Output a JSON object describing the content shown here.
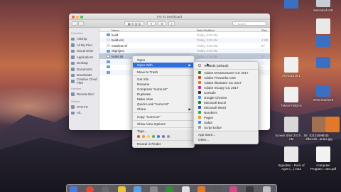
{
  "finder": {
    "title": "FIX IO Dashboard",
    "search_placeholder": "Search",
    "col_name": "Name",
    "col_date": "Date Modified",
    "col_size": "Size",
    "sidebar_heading_favorites": "Favorites",
    "sidebar_favorites": [
      "AirDrop",
      "All My Files",
      "iCloud Drive",
      "Applications",
      "Desktop",
      "Documents",
      "Downloads",
      "Creative Cloud Files"
    ],
    "sidebar_heading_devices": "Devices",
    "sidebar_devices": [
      "Remote Disc"
    ],
    "sidebar_heading_shared": "Shared",
    "sidebar_shared": [
      "STG-FS",
      "All..."
    ],
    "rows": [
      {
        "name": "build",
        "date": "Today, 3:00 AM",
        "size": "--"
      },
      {
        "name": "build.xml",
        "date": "Today, 3:00 AM",
        "size": "4 KB"
      },
      {
        "name": "manifest.mf",
        "date": "Today, 3:00 AM",
        "size": "97 bytes"
      },
      {
        "name": "nbproject",
        "date": "Today, 3:00 AM",
        "size": "--"
      },
      {
        "name": "nums.txt",
        "date": "Today, 3:00 AM",
        "size": "21 bytes"
      },
      {
        "name": "",
        "date": "Today, 3:00 AM",
        "size": "--"
      },
      {
        "name": "",
        "date": "Today, 3:00 AM",
        "size": "--"
      },
      {
        "name": "",
        "date": "Today, 3:00 AM",
        "size": "--"
      }
    ]
  },
  "context_menu": {
    "open": "Open",
    "open_with": "Open With",
    "move_to_trash": "Move to Trash",
    "get_info": "Get Info",
    "rename": "Rename",
    "compress": "Compress \"nums.txt\"",
    "duplicate": "Duplicate",
    "make_alias": "Make Alias",
    "quick_look": "Quick Look \"nums.txt\"",
    "share": "Share",
    "copy": "Copy \"nums.txt\"",
    "show_view_options": "Show View Options",
    "tags": "Tags...",
    "reveal": "Reveal in Finder"
  },
  "open_with_menu": {
    "items": [
      {
        "label": "TextEdit (default)",
        "color": "#e8e8e8"
      },
      {
        "label": "Adobe Dreamweaver CC 2017",
        "color": "#3a7d3a"
      },
      {
        "label": "Adobe Fireworks CS6",
        "color": "#b5502b"
      },
      {
        "label": "Adobe Illustrator CC 2017",
        "color": "#d97a1a"
      },
      {
        "label": "Adobe InCopy CC 2017",
        "color": "#b03a7a"
      },
      {
        "label": "Console",
        "color": "#333333"
      },
      {
        "label": "Google Chrome",
        "color": "#4a8fd9"
      },
      {
        "label": "Microsoft Excel",
        "color": "#1f7a3a"
      },
      {
        "label": "Microsoft Word",
        "color": "#2a56a8"
      },
      {
        "label": "Numbers",
        "color": "#3ea54a"
      },
      {
        "label": "Pages",
        "color": "#e89a2a"
      },
      {
        "label": "Safari",
        "color": "#3a8fd9"
      },
      {
        "label": "Script Editor",
        "color": "#9a9a9a"
      }
    ],
    "app_store": "App Store...",
    "other": "Other..."
  },
  "tag_colors": [
    "#e04a3a",
    "#f09a2a",
    "#f5d23a",
    "#5ab04a",
    "#3a7ae0",
    "#9a5ad0",
    "#9a9a9a"
  ],
  "desktop_icons": [
    {
      "label": "Macintosh HD",
      "color": "#c9ccd2"
    },
    {
      "label": "",
      "color": "#3a6fc2"
    },
    {
      "label": "",
      "color": "#e9e9e9"
    },
    {
      "label": "ANAD1310.1",
      "color": "#f0f0f0"
    },
    {
      "label": "",
      "color": "#3a6fc2"
    },
    {
      "label": "",
      "color": "#3a6fc2"
    },
    {
      "label": "TMAN-TW02-5",
      "color": "#f0f0f0"
    },
    {
      "label": "",
      "color": "#f0f0f0"
    },
    {
      "label": "STIG teacher8",
      "color": "#3a6fc2"
    },
    {
      "label": "Screen Shot 2017-...06 AM",
      "color": "#d8d8d8"
    },
    {
      "label": "b31b3098b4b 2fbe12b...antes.jpg",
      "color": "#a07050"
    },
    {
      "label": "",
      "color": "#e07a2a"
    },
    {
      "label": "Signation - Rock of Ages (...).m4a",
      "color": "#e8e8e8"
    },
    {
      "label": "Computer Program...ntes.pdf",
      "color": "#f2f2f2"
    }
  ],
  "dock_colors": [
    "#4a7ad9",
    "#e04a3a",
    "#6a6a6a",
    "#e8c23a",
    "#5aa0e0",
    "#8a8a8a",
    "#3a8a3a",
    "#e0e0e0",
    "#e07a2a",
    "#5a5a5a",
    "#d04a8a",
    "#3a3a3a",
    "#3ab0e0",
    "#8a6ad0",
    "#b0b0b0",
    "#c0c0c0"
  ]
}
